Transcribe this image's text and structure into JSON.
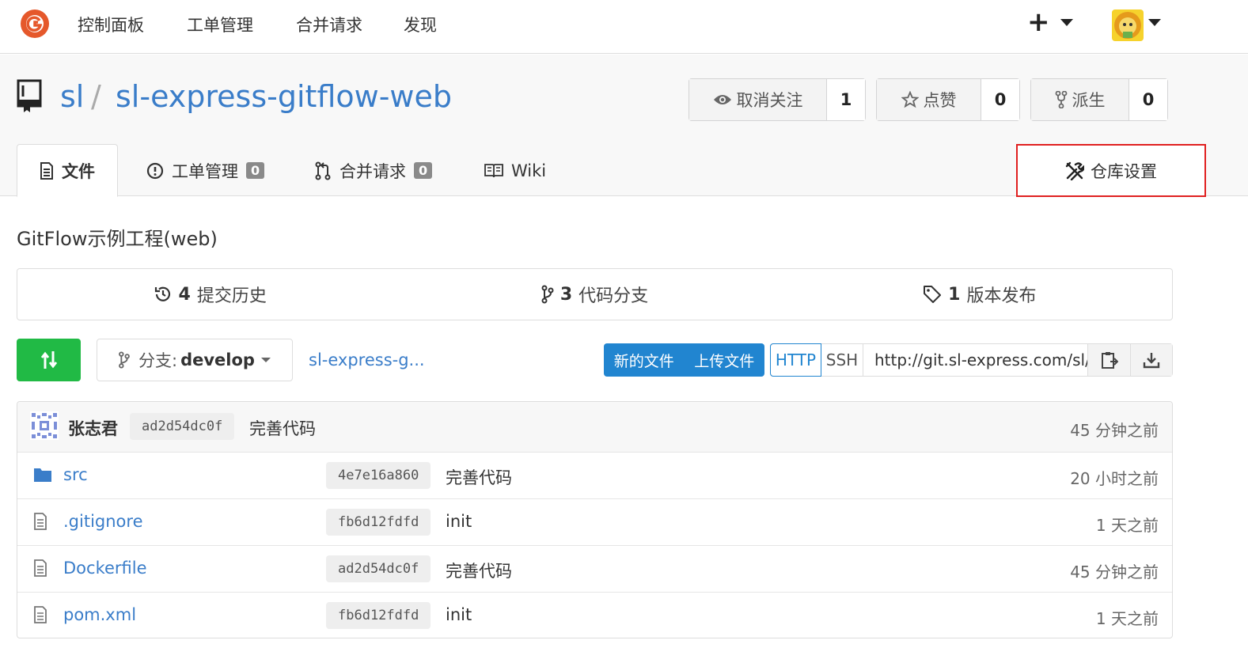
{
  "nav": {
    "items": [
      "控制面板",
      "工单管理",
      "合并请求",
      "发现"
    ]
  },
  "repo": {
    "owner": "sl",
    "separator": "/",
    "name": "sl-express-gitflow-web",
    "watch": {
      "label": "取消关注",
      "count": "1"
    },
    "star": {
      "label": "点赞",
      "count": "0"
    },
    "fork": {
      "label": "派生",
      "count": "0"
    }
  },
  "tabs": {
    "files": "文件",
    "issues": "工单管理",
    "issues_count": "0",
    "pulls": "合并请求",
    "pulls_count": "0",
    "wiki": "Wiki",
    "settings": "仓库设置"
  },
  "description": "GitFlow示例工程(web)",
  "stats": {
    "commits_num": "4",
    "commits_label": "提交历史",
    "branches_num": "3",
    "branches_label": "代码分支",
    "releases_num": "1",
    "releases_label": "版本发布"
  },
  "toolbar": {
    "branch_prefix": "分支:",
    "branch_name": "develop",
    "breadcrumb": "sl-express-g...",
    "new_file": "新的文件",
    "upload_file": "上传文件",
    "http": "HTTP",
    "ssh": "SSH",
    "clone_url": "http://git.sl-express.com/sl/"
  },
  "latest_commit": {
    "author": "张志君",
    "sha": "ad2d54dc0f",
    "message": "完善代码",
    "time": "45 分钟之前"
  },
  "files": [
    {
      "type": "folder",
      "name": "src",
      "sha": "4e7e16a860",
      "message": "完善代码",
      "time": "20 小时之前"
    },
    {
      "type": "file",
      "name": ".gitignore",
      "sha": "fb6d12fdfd",
      "message": "init",
      "time": "1 天之前"
    },
    {
      "type": "file",
      "name": "Dockerfile",
      "sha": "ad2d54dc0f",
      "message": "完善代码",
      "time": "45 分钟之前"
    },
    {
      "type": "file",
      "name": "pom.xml",
      "sha": "fb6d12fdfd",
      "message": "init",
      "time": "1 天之前"
    }
  ],
  "colors": {
    "link": "#3a7dc9",
    "primary": "#2185d0",
    "green": "#21ba45",
    "highlight": "#e02020",
    "logo": "#e5582b"
  }
}
